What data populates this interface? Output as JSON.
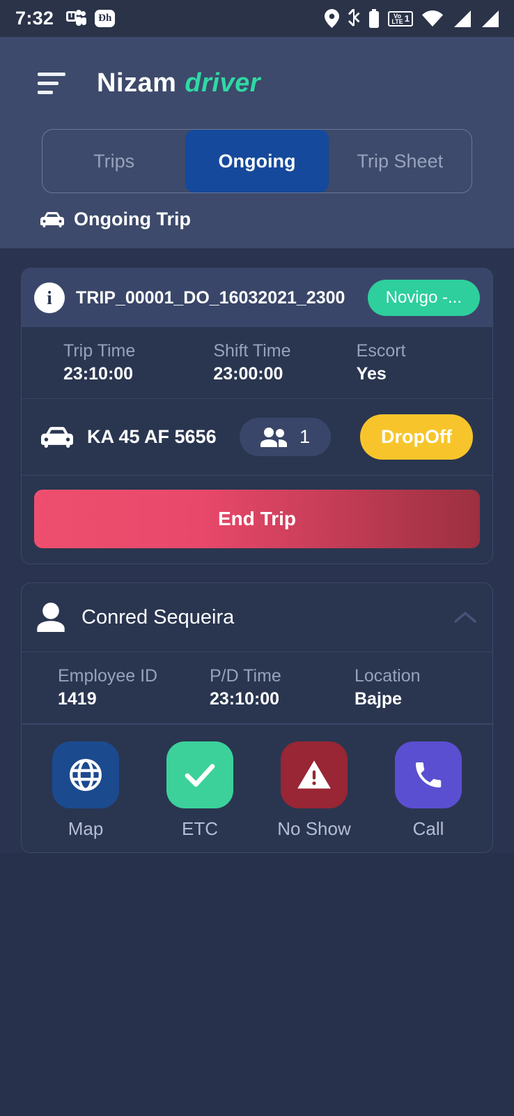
{
  "status_bar": {
    "time": "7:32",
    "left_icons": [
      "teams-icon",
      "hotstar-icon"
    ],
    "right_icons": [
      "location-icon",
      "bluetooth-icon",
      "battery-icon",
      "volte-icon",
      "wifi-icon",
      "signal-icon",
      "signal-icon"
    ],
    "volte_label_top": "Vo",
    "volte_label_bottom": "LTE",
    "sim_number": "1"
  },
  "app_bar": {
    "menu_icon": "hamburger-icon",
    "title": "Nizam",
    "role": "driver"
  },
  "tabs": [
    {
      "label": "Trips",
      "active": false
    },
    {
      "label": "Ongoing",
      "active": true
    },
    {
      "label": "Trip Sheet",
      "active": false
    }
  ],
  "section": {
    "icon": "car-icon",
    "label": "Ongoing Trip"
  },
  "trip_card": {
    "info_icon": "info-icon",
    "trip_id": "TRIP_00001_DO_16032021_2300",
    "badge": "Novigo -...",
    "stats": [
      {
        "key": "Trip Time",
        "value": "23:10:00"
      },
      {
        "key": "Shift Time",
        "value": "23:00:00"
      },
      {
        "key": "Escort",
        "value": "Yes"
      }
    ],
    "vehicle_icon": "car-icon",
    "vehicle_number": "KA 45 AF 5656",
    "passenger_icon": "people-icon",
    "passenger_count": "1",
    "dropoff_label": "DropOff",
    "end_trip_label": "End Trip"
  },
  "passenger_card": {
    "avatar_icon": "person-icon",
    "name": "Conred Sequeira",
    "collapse_icon": "chevron-up-icon",
    "details": [
      {
        "key": "Employee ID",
        "value": "1419"
      },
      {
        "key": "P/D Time",
        "value": "23:10:00"
      },
      {
        "key": "Location",
        "value": "Bajpe"
      }
    ],
    "actions": [
      {
        "label": "Map",
        "icon": "globe-icon"
      },
      {
        "label": "ETC",
        "icon": "check-icon"
      },
      {
        "label": "No Show",
        "icon": "warning-icon"
      },
      {
        "label": "Call",
        "icon": "phone-icon"
      }
    ]
  },
  "colors": {
    "app_bar": "#3d4a6b",
    "body": "#2a3450",
    "card": "#2a3650",
    "card_head": "#3a4669",
    "accent_green": "#2ecf9d",
    "tab_active": "#15499b",
    "dropoff_yellow": "#f7c52b",
    "end_trip_from": "#ef4f6e",
    "end_trip_to": "#9c3040",
    "map_blue": "#1c4a8f",
    "etc_green": "#3cd19b",
    "noshow_red": "#982635",
    "call_purple": "#5b4fd1"
  }
}
